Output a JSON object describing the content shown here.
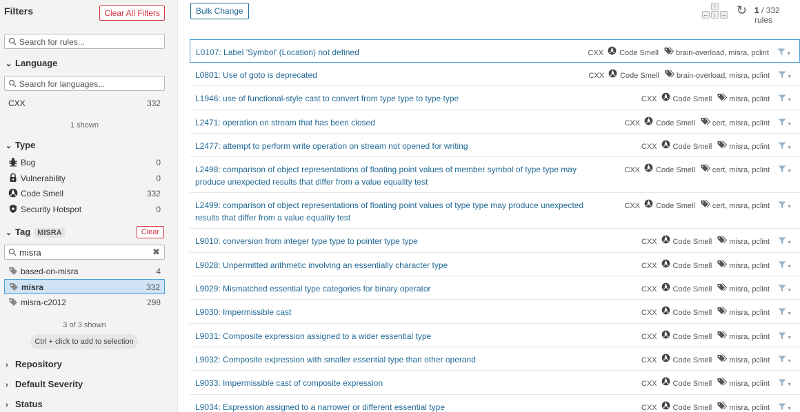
{
  "sidebar": {
    "title": "Filters",
    "clear_all": "Clear All Filters",
    "rule_search_placeholder": "Search for rules...",
    "language": {
      "title": "Language",
      "search_placeholder": "Search for languages...",
      "items": [
        {
          "label": "CXX",
          "count": "332"
        }
      ],
      "shown": "1 shown"
    },
    "type": {
      "title": "Type",
      "items": [
        {
          "label": "Bug",
          "count": "0",
          "icon": "bug-icon"
        },
        {
          "label": "Vulnerability",
          "count": "0",
          "icon": "lock-icon"
        },
        {
          "label": "Code Smell",
          "count": "332",
          "icon": "code-smell-icon"
        },
        {
          "label": "Security Hotspot",
          "count": "0",
          "icon": "shield-icon"
        }
      ]
    },
    "tag": {
      "title": "Tag",
      "badge": "MISRA",
      "clear": "Clear",
      "search_value": "misra",
      "items": [
        {
          "label": "based-on-misra",
          "count": "4"
        },
        {
          "label": "misra",
          "count": "332",
          "selected": true
        },
        {
          "label": "misra-c2012",
          "count": "298"
        }
      ],
      "shown": "3 of 3 shown",
      "hint": "Ctrl + click to add to selection"
    },
    "collapsed": [
      {
        "label": "Repository"
      },
      {
        "label": "Default Severity"
      },
      {
        "label": "Status"
      }
    ]
  },
  "toolbar": {
    "bulk_change": "Bulk Change",
    "counter_current": "1",
    "counter_rest": " / 332 rules"
  },
  "rules": [
    {
      "title": "L0107: Label 'Symbol' (Location) not defined",
      "lang": "CXX",
      "type": "Code Smell",
      "tags": "brain-overload, misra, pclint"
    },
    {
      "title": "L0801: Use of goto is deprecated",
      "lang": "CXX",
      "type": "Code Smell",
      "tags": "brain-overload, misra, pclint"
    },
    {
      "title": "L1946: use of functional-style cast to convert from type type to type type",
      "lang": "CXX",
      "type": "Code Smell",
      "tags": "misra, pclint"
    },
    {
      "title": "L2471: operation on stream that has been closed",
      "lang": "CXX",
      "type": "Code Smell",
      "tags": "cert, misra, pclint"
    },
    {
      "title": "L2477: attempt to perform write operation on stream not opened for writing",
      "lang": "CXX",
      "type": "Code Smell",
      "tags": "misra, pclint"
    },
    {
      "title": "L2498: comparison of object representations of floating point values of member symbol of type type may produce unexpected results that differ from a value equality test",
      "lang": "CXX",
      "type": "Code Smell",
      "tags": "cert, misra, pclint"
    },
    {
      "title": "L2499: comparison of object representations of floating point values of type type may produce unexpected results that differ from a value equality test",
      "lang": "CXX",
      "type": "Code Smell",
      "tags": "cert, misra, pclint"
    },
    {
      "title": "L9010: conversion from integer type type to pointer type type",
      "lang": "CXX",
      "type": "Code Smell",
      "tags": "misra, pclint"
    },
    {
      "title": "L9028: Unpermitted arithmetic involving an essentially character type",
      "lang": "CXX",
      "type": "Code Smell",
      "tags": "misra, pclint"
    },
    {
      "title": "L9029: Mismatched essential type categories for binary operator",
      "lang": "CXX",
      "type": "Code Smell",
      "tags": "misra, pclint"
    },
    {
      "title": "L9030: Impermissible cast",
      "lang": "CXX",
      "type": "Code Smell",
      "tags": "misra, pclint"
    },
    {
      "title": "L9031: Composite expression assigned to a wider essential type",
      "lang": "CXX",
      "type": "Code Smell",
      "tags": "misra, pclint"
    },
    {
      "title": "L9032: Composite expression with smaller essential type than other operand",
      "lang": "CXX",
      "type": "Code Smell",
      "tags": "misra, pclint"
    },
    {
      "title": "L9033: Impermissible cast of composite expression",
      "lang": "CXX",
      "type": "Code Smell",
      "tags": "misra, pclint"
    },
    {
      "title": "L9034: Expression assigned to a narrower or different essential type",
      "lang": "CXX",
      "type": "Code Smell",
      "tags": "misra, pclint"
    }
  ]
}
